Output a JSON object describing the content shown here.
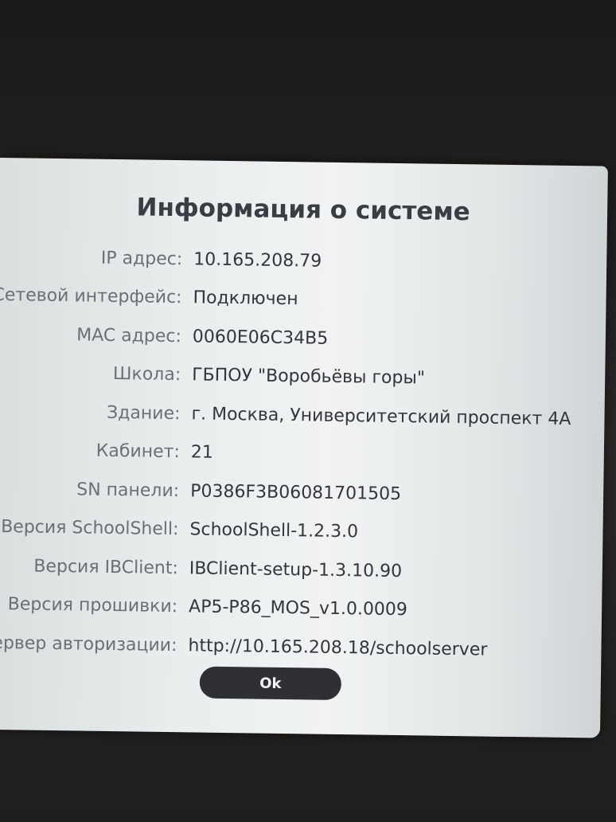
{
  "dialog": {
    "title": "Информация о системе",
    "rows": [
      {
        "label": "IP адрес:",
        "value": "10.165.208.79"
      },
      {
        "label": "Сетевой интерфейс:",
        "value": "Подключен"
      },
      {
        "label": "MAC адрес:",
        "value": "0060E06C34B5"
      },
      {
        "label": "Школа:",
        "value": "ГБПОУ \"Воробьёвы горы\""
      },
      {
        "label": "Здание:",
        "value": "г. Москва, Университетский проспект 4А"
      },
      {
        "label": "Кабинет:",
        "value": "21"
      },
      {
        "label": "SN панели:",
        "value": "P0386F3B06081701505"
      },
      {
        "label": "Версия SchoolShell:",
        "value": "SchoolShell-1.2.3.0"
      },
      {
        "label": "Версия IBClient:",
        "value": "IBClient-setup-1.3.10.90"
      },
      {
        "label": "Версия прошивки:",
        "value": "AP5-P86_MOS_v1.0.0009"
      },
      {
        "label": "Сервер авторизации:",
        "value": "http://10.165.208.18/schoolserver"
      }
    ],
    "ok_label": "Ok"
  },
  "colors": {
    "dialog_background": "#eceff0",
    "title_text": "#3b3d44",
    "label_text": "#6c6f75",
    "value_text": "#34363d",
    "button_background": "#2e3036",
    "button_text": "#f2f2f2"
  }
}
